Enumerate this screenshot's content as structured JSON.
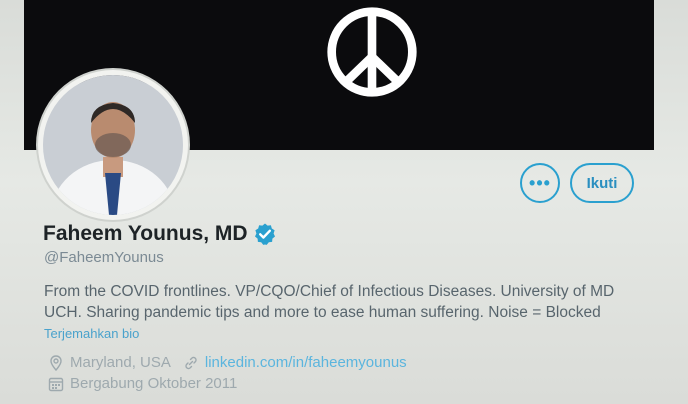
{
  "banner": {
    "bg": "#0b0b0d",
    "icon": "peace-sign"
  },
  "profile": {
    "name": "Faheem Younus, MD",
    "handle": "@FaheemYounus",
    "verified": true,
    "bio_line1": "From the COVID frontlines. VP/CQO/Chief of Infectious Diseases. University of MD",
    "bio_line2": "UCH. Sharing pandemic tips and more to ease human suffering. Noise = Blocked",
    "translate": "Terjemahkan bio",
    "location": "Maryland, USA",
    "website": "linkedin.com/in/faheemyounus",
    "joined": "Bergabung Oktober 2011"
  },
  "actions": {
    "more": "•••",
    "follow": "Ikuti"
  },
  "colors": {
    "accent": "#2aa0cf",
    "name": "#1d2326",
    "muted": "#7b8a94"
  }
}
